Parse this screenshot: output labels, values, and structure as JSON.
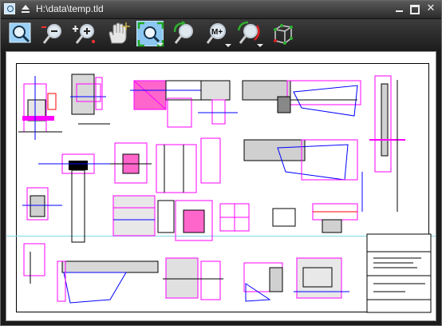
{
  "window": {
    "title": "H:\\data\\temp.tld",
    "icons": {
      "app": "viewer-app-icon",
      "collapse": "collapse-arrow-icon"
    },
    "controls": {
      "minimize": "minimize-icon",
      "maximize": "maximize-icon",
      "close": "close-icon",
      "close_glyph": "✕"
    }
  },
  "toolbar": {
    "tools": [
      {
        "id": "zoom-window",
        "icon": "zoom-window-icon",
        "selected": false,
        "has_dropdown": false
      },
      {
        "id": "zoom-out",
        "icon": "zoom-out-icon",
        "selected": false,
        "has_dropdown": false
      },
      {
        "id": "zoom-in",
        "icon": "zoom-in-icon",
        "selected": false,
        "has_dropdown": false
      },
      {
        "id": "pan",
        "icon": "pan-hand-icon",
        "selected": false,
        "has_dropdown": false
      },
      {
        "id": "zoom-extents",
        "icon": "zoom-extents-icon",
        "selected": true,
        "has_dropdown": true
      },
      {
        "id": "zoom-previous",
        "icon": "zoom-previous-icon",
        "selected": false,
        "has_dropdown": false
      },
      {
        "id": "zoom-memory",
        "icon": "zoom-memory-icon",
        "selected": false,
        "has_dropdown": true
      },
      {
        "id": "rotate-view",
        "icon": "rotate-view-icon",
        "selected": false,
        "has_dropdown": true
      },
      {
        "id": "3d-view",
        "icon": "3d-cube-icon",
        "selected": false,
        "has_dropdown": false
      }
    ],
    "zoom_memory_label": "M+"
  },
  "colors": {
    "accent": "#8cc7f1",
    "canvas": "#ffffff",
    "cad_magenta": "#ff00ff",
    "cad_blue": "#0000ff",
    "cad_red": "#ff0000",
    "cad_cyan": "#7fd7e6"
  }
}
